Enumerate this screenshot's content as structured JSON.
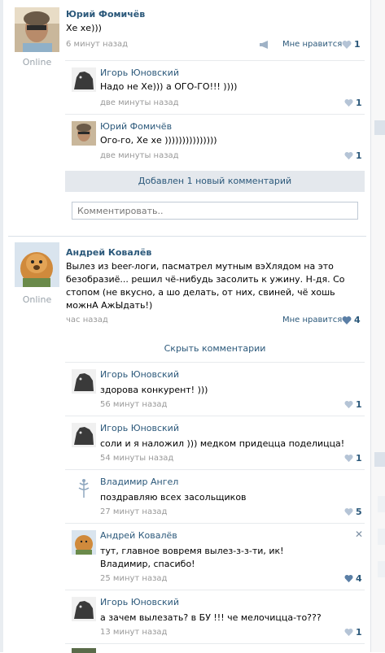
{
  "posts": [
    {
      "author": "Юрий Фомичёв",
      "status": "Online",
      "text": "Хе хе)))",
      "time": "6 минут назад",
      "like_label": "Мне нравится",
      "likes": "1",
      "comments": [
        {
          "author": "Игорь Юновский",
          "lines": [
            "Надо не Хе))) а ОГО-ГО!!! ))))"
          ],
          "time": "две минуты назад",
          "likes": "1"
        },
        {
          "author": "Юрий Фомичёв",
          "lines": [
            "Ого-го, Хе хе )))))))))))))))"
          ],
          "time": "две минуты назад",
          "likes": "1"
        }
      ],
      "new_comment_bar": "Добавлен 1 новый комментарий",
      "comment_placeholder": "Комментировать.."
    },
    {
      "author": "Андрей Ковалёв",
      "status": "Online",
      "text_lines": [
        "Вылез из beer-логи, пасматрел мутным вэХлядом на это",
        "безобразиё... решил чё-нибудь засолить к ужину. Н-дя. Со",
        "стопом (не вкусно, а шо делать, от них, свиней, чё хошь",
        "можнА АжЫдать!)"
      ],
      "time": "час назад",
      "like_label": "Мне нравится",
      "likes": "4",
      "hide_comments": "Скрыть комментарии",
      "comments": [
        {
          "author": "Игорь Юновский",
          "lines": [
            "здорова конкурент! )))"
          ],
          "time": "56 минут назад",
          "likes": "1"
        },
        {
          "author": "Игорь Юновский",
          "lines": [
            "соли и я наложил ))) медком придецца поделицца!"
          ],
          "time": "54 минуты назад",
          "likes": "1"
        },
        {
          "author": "Владимир Ангел",
          "lines": [
            "поздравляю всех засольщиков"
          ],
          "time": "27 минут назад",
          "likes": "5"
        },
        {
          "author": "Андрей Ковалёв",
          "lines": [
            "тут, главное вовремя вылез-з-з-ти, ик!",
            "Владимир, спасибо!"
          ],
          "time": "25 минут назад",
          "likes": "4"
        },
        {
          "author": "Игорь Юновский",
          "lines": [
            "а зачем вылезать? в БУ !!! че мелочицца-то???"
          ],
          "time": "13 минут назад",
          "likes": "1"
        }
      ]
    }
  ],
  "colors": {
    "link": "#2b587a",
    "muted": "#999999",
    "bar": "#e4e8ed",
    "heart": "#b5c4d6",
    "heart_active": "#5b7fa6"
  }
}
